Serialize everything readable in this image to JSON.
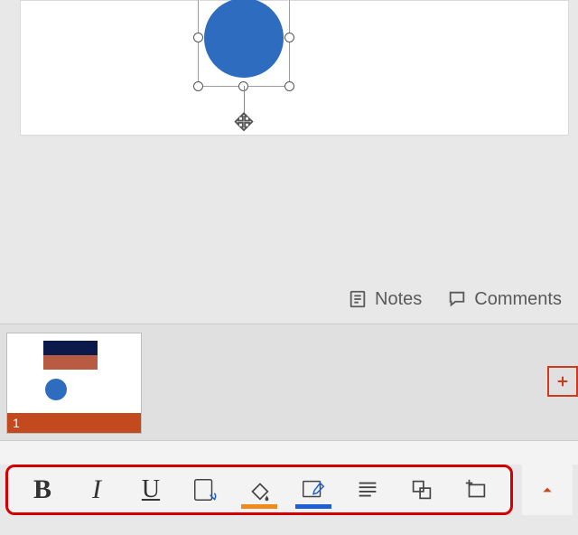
{
  "meta": {
    "notes_label": "Notes",
    "comments_label": "Comments"
  },
  "thumbnails": {
    "slides": [
      {
        "index": "1"
      }
    ],
    "new_slide_icon": "plus-icon"
  },
  "toolbar": {
    "buttons": [
      {
        "name": "bold-button",
        "glyph": "B"
      },
      {
        "name": "italic-button",
        "glyph": "I"
      },
      {
        "name": "underline-button",
        "glyph": "U"
      },
      {
        "name": "font-style-button"
      },
      {
        "name": "fill-color-button",
        "swatch": "#ef8a1b"
      },
      {
        "name": "outline-color-button",
        "swatch": "#1f5fd6"
      },
      {
        "name": "paragraph-button"
      },
      {
        "name": "arrange-button"
      },
      {
        "name": "insert-textbox-button"
      }
    ],
    "collapse_icon": "chevron-up-icon"
  },
  "canvas": {
    "selected_shape": {
      "type": "circle",
      "fill": "#2e6cc0"
    }
  }
}
